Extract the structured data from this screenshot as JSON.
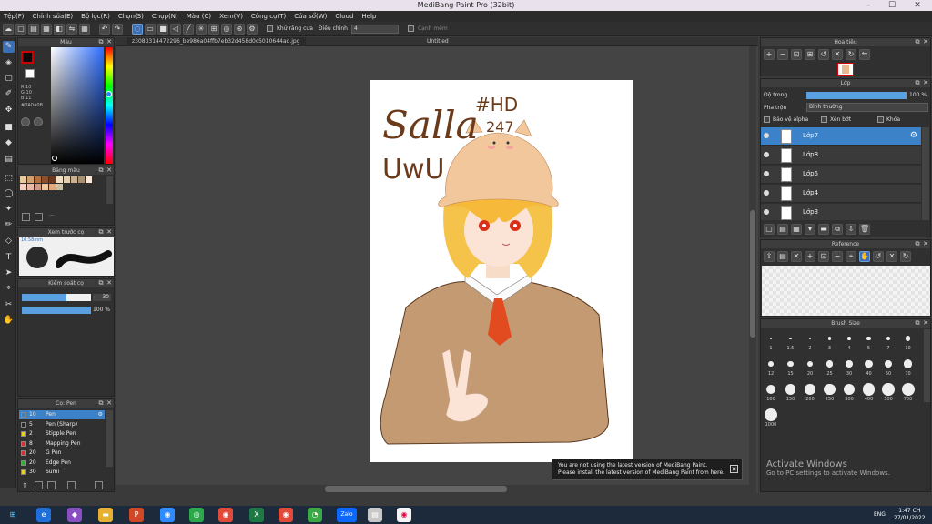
{
  "window": {
    "title": "MediBang Paint Pro (32bit)",
    "minimize": "–",
    "maximize": "☐",
    "close": "✕"
  },
  "menu": [
    "Tệp(F)",
    "Chỉnh sửa(E)",
    "Bộ lọc(R)",
    "Chọn(S)",
    "Chụp(N)",
    "Màu (C)",
    "Xem(V)",
    "Công cụ(T)",
    "Cửa sổ(W)",
    "Cloud",
    "Help"
  ],
  "toolbar": {
    "antialias_label": "Khử răng cưa",
    "adjust_label": "Điều chỉnh",
    "adjust_value": "4",
    "blur_label": "Cạnh mềm"
  },
  "doc_tabs": [
    "z3083314472296_be986a04ffb7eb32d458d0c5010644ad.jpg",
    "Untitled"
  ],
  "color_panel": {
    "title": "Màu",
    "r": "R:10",
    "g": "G:10",
    "b": "B:11",
    "hex": "#0A0A0B",
    "main_color": "#0a0a0b"
  },
  "palette_panel": {
    "title": "Bảng màu",
    "more": "···",
    "swatches": [
      "#e8c9a0",
      "#d2a070",
      "#b07040",
      "#8a5030",
      "#6a3a20",
      "#f0e0c8",
      "#e0d0b0",
      "#c8b090",
      "#a89070",
      "#fce8d8",
      "#f5d0c0",
      "#e8b8a8",
      "#d09888",
      "#f0c8a0",
      "#e0a880",
      "#c8c0a0"
    ]
  },
  "brush_preview": {
    "title": "Xem trước cọ",
    "size": "10.58mm"
  },
  "brush_control": {
    "title": "Kiểm soát cọ",
    "size_value": "30",
    "size_percent": 0.65,
    "opacity_value": "100 %",
    "opacity_percent": 1.0
  },
  "brush_list": {
    "title": "Cọ: Pen",
    "items": [
      {
        "color": "#3c82c8",
        "size": "10",
        "name": "Pen",
        "selected": true
      },
      {
        "color": "#2a2a2a",
        "size": "5",
        "name": "Pen (Sharp)",
        "selected": false
      },
      {
        "color": "#e8d020",
        "size": "2",
        "name": "Stipple Pen",
        "selected": false
      },
      {
        "color": "#d83030",
        "size": "8",
        "name": "Mapping Pen",
        "selected": false
      },
      {
        "color": "#d83030",
        "size": "20",
        "name": "G Pen",
        "selected": false
      },
      {
        "color": "#30b030",
        "size": "20",
        "name": "Edge Pen",
        "selected": false
      },
      {
        "color": "#e8d020",
        "size": "30",
        "name": "Sumi",
        "selected": false
      }
    ]
  },
  "navigator": {
    "title": "Hoa tiêu"
  },
  "layers": {
    "title": "Lớp",
    "opacity_label": "Độ trong",
    "opacity_value": "100 %",
    "opacity_percent": 1.0,
    "blend_label": "Pha trộn",
    "blend_value": "Bình thường",
    "protect_alpha": "Bảo vệ alpha",
    "clipping": "Xén bớt",
    "lock": "Khóa",
    "items": [
      {
        "name": "Lớp7",
        "selected": true
      },
      {
        "name": "Lớp8",
        "selected": false
      },
      {
        "name": "Lớp5",
        "selected": false
      },
      {
        "name": "Lớp4",
        "selected": false
      },
      {
        "name": "Lớp3",
        "selected": false
      }
    ]
  },
  "reference": {
    "title": "Reference"
  },
  "brush_size": {
    "title": "Brush Size",
    "sizes": [
      "1",
      "1.5",
      "2",
      "3",
      "4",
      "5",
      "7",
      "10",
      "12",
      "15",
      "20",
      "25",
      "30",
      "40",
      "50",
      "70",
      "100",
      "150",
      "200",
      "250",
      "300",
      "400",
      "500",
      "700",
      "1000"
    ]
  },
  "artwork": {
    "text1": "Salla",
    "text2": "#HD",
    "text3": "247",
    "text4": "UwU"
  },
  "notice": {
    "line1": "You are not using the latest version of MediBang Paint.",
    "line2": "Please install the latest version of MediBang Paint from here."
  },
  "activation": {
    "title": "Activate Windows",
    "subtitle": "Go to PC settings to activate Windows."
  },
  "tray": {
    "time": "1:47 CH",
    "date": "27/01/2022",
    "lang": "ENG"
  }
}
